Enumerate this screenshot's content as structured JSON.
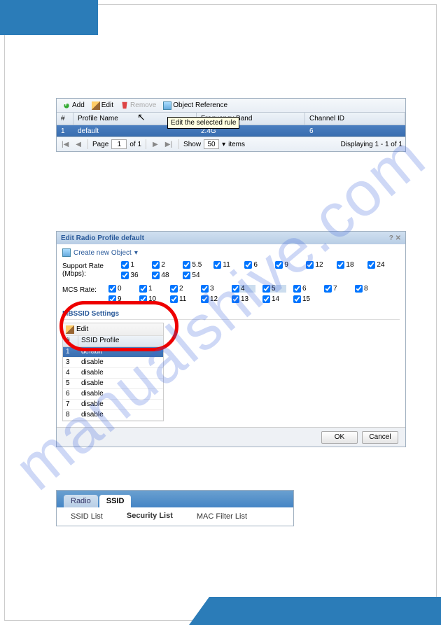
{
  "watermark": "manualshive.com",
  "section1": {
    "toolbar": {
      "add": "Add",
      "edit": "Edit",
      "remove": "Remove",
      "object_ref": "Object Reference"
    },
    "tooltip": "Edit the selected rule",
    "columns": {
      "num": "#",
      "profile": "Profile Name",
      "freq": "Frequency Band",
      "channel": "Channel ID"
    },
    "row": {
      "num": "1",
      "profile": "default",
      "freq": "2.4G",
      "channel": "6"
    },
    "pager": {
      "page_label": "Page",
      "page": "1",
      "of": "of 1",
      "show": "Show",
      "per": "50",
      "items": "items",
      "display": "Displaying 1 - 1 of 1"
    }
  },
  "section2": {
    "title": "Edit Radio Profile default",
    "create": "Create new Object",
    "support_label": "Support Rate (Mbps):",
    "support_rates": [
      "1",
      "2",
      "5.5",
      "11",
      "6",
      "9",
      "12",
      "18",
      "24",
      "36",
      "48",
      "54"
    ],
    "mcs_label": "MCS Rate:",
    "mcs_rates": [
      "0",
      "1",
      "2",
      "3",
      "4",
      "5",
      "6",
      "7",
      "8",
      "9",
      "10",
      "11",
      "12",
      "13",
      "14",
      "15"
    ],
    "mcs_highlight": [
      "4",
      "5"
    ],
    "mbssid_title": "MBSSID Settings",
    "mb_edit": "Edit",
    "mb_cols": {
      "num": "#",
      "profile": "SSID Profile"
    },
    "mb_rows": [
      {
        "n": "1",
        "p": "default"
      },
      {
        "n": "3",
        "p": "disable"
      },
      {
        "n": "4",
        "p": "disable"
      },
      {
        "n": "5",
        "p": "disable"
      },
      {
        "n": "6",
        "p": "disable"
      },
      {
        "n": "7",
        "p": "disable"
      },
      {
        "n": "8",
        "p": "disable"
      }
    ],
    "ok": "OK",
    "cancel": "Cancel"
  },
  "section3": {
    "tabs": {
      "radio": "Radio",
      "ssid": "SSID"
    },
    "subtabs": {
      "ssid_list": "SSID List",
      "security": "Security List",
      "mac": "MAC Filter List"
    }
  }
}
